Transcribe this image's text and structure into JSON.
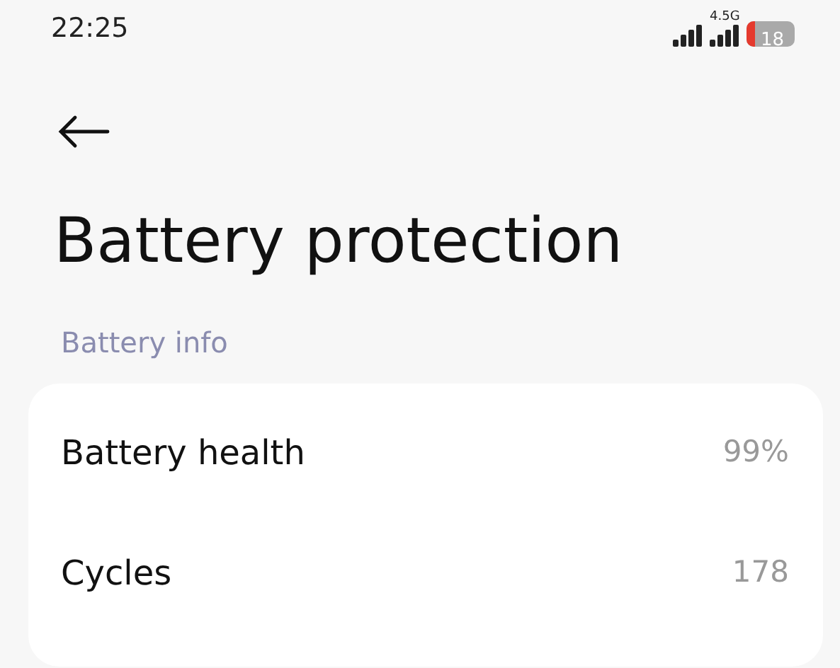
{
  "status_bar": {
    "time": "22:25",
    "network": "4.5G",
    "battery": "18"
  },
  "title": "Battery protection",
  "section": "Battery info",
  "rows": [
    {
      "label": "Battery health",
      "value": "99%"
    },
    {
      "label": "Cycles",
      "value": "178"
    }
  ]
}
